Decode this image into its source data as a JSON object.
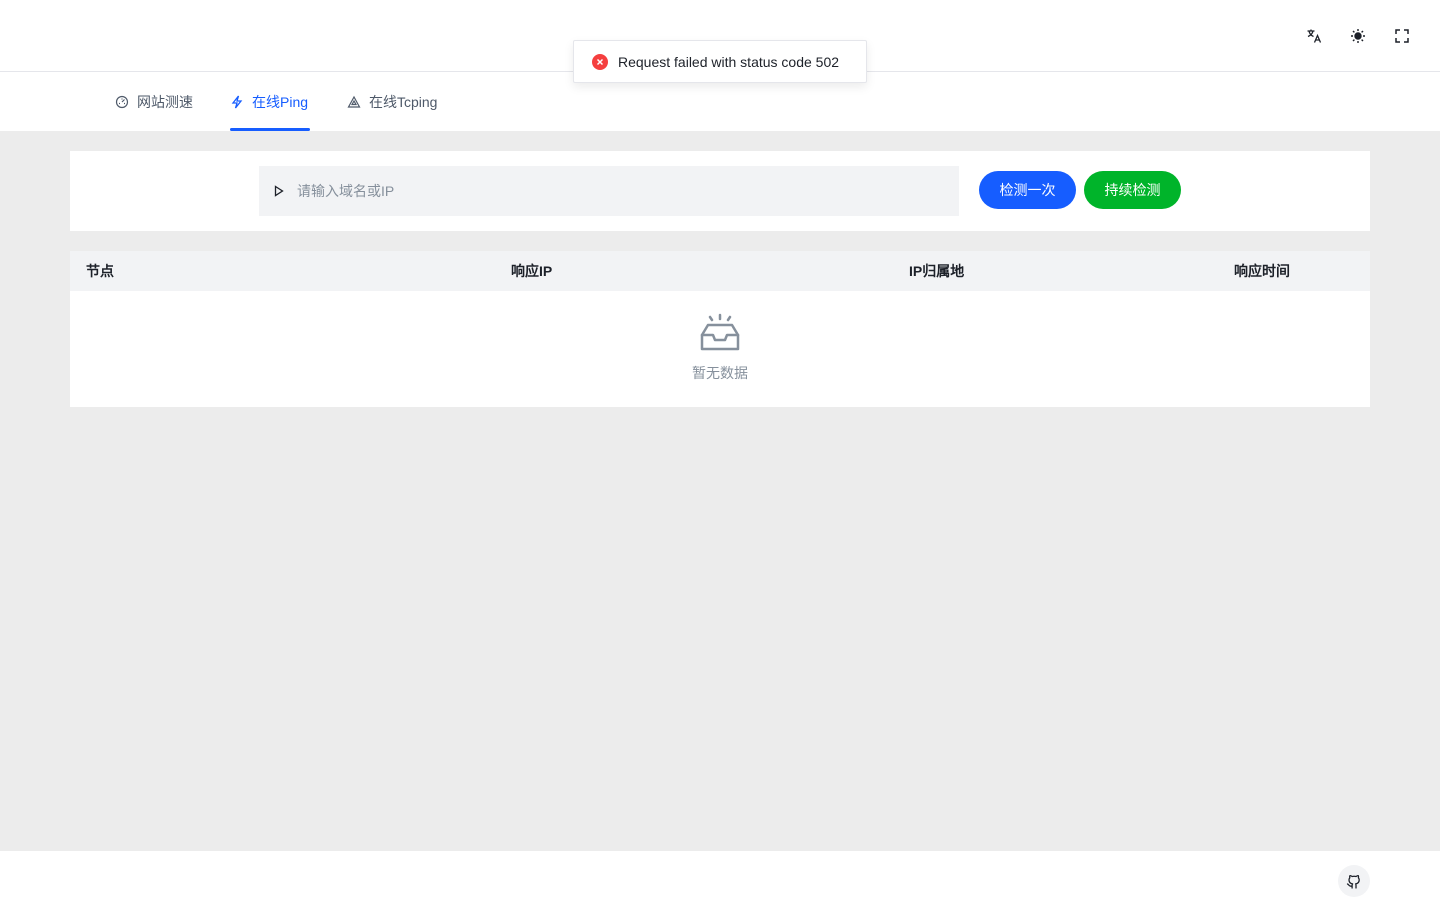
{
  "toast": {
    "message": "Request failed with status code 502",
    "type": "error",
    "color": "#f53f3f"
  },
  "header": {
    "icons": [
      "translate-icon",
      "sun-icon",
      "fullscreen-icon"
    ]
  },
  "tabs": [
    {
      "label": "网站测速",
      "icon": "speed-icon",
      "active": false
    },
    {
      "label": "在线Ping",
      "icon": "lightning-icon",
      "active": true
    },
    {
      "label": "在线Tcping",
      "icon": "triangle-icon",
      "active": false
    }
  ],
  "search": {
    "placeholder": "请输入域名或IP",
    "value": "",
    "btn_once": "检测一次",
    "btn_continuous": "持续检测"
  },
  "table": {
    "columns": [
      "节点",
      "响应IP",
      "IP归属地",
      "响应时间"
    ],
    "rows": [],
    "empty_text": "暂无数据"
  },
  "colors": {
    "primary": "#165dff",
    "success": "#00b42a",
    "background": "#ececec"
  },
  "footer": {
    "icon": "github-icon"
  }
}
